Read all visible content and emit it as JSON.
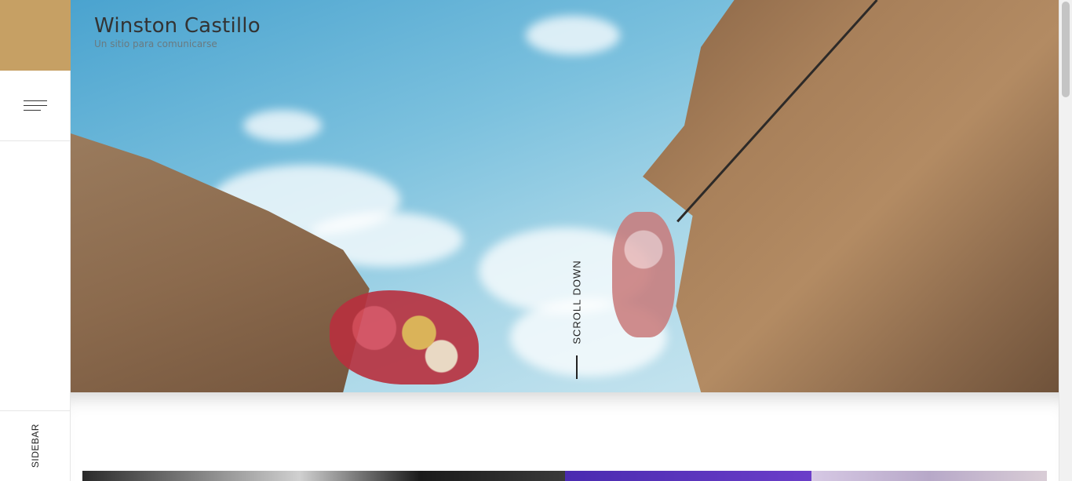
{
  "site": {
    "title": "Winston Castillo",
    "tagline": "Un sitio para comunicarse"
  },
  "hero": {
    "scroll_label": "SCROLL DOWN"
  },
  "rail": {
    "menu_icon": "hamburger-icon",
    "sidebar_label": "SIDEBAR",
    "accent_color": "#c6a064"
  },
  "posts": {
    "thumbnails": [
      "post-thumbnail-1",
      "post-thumbnail-2",
      "post-thumbnail-3"
    ]
  }
}
